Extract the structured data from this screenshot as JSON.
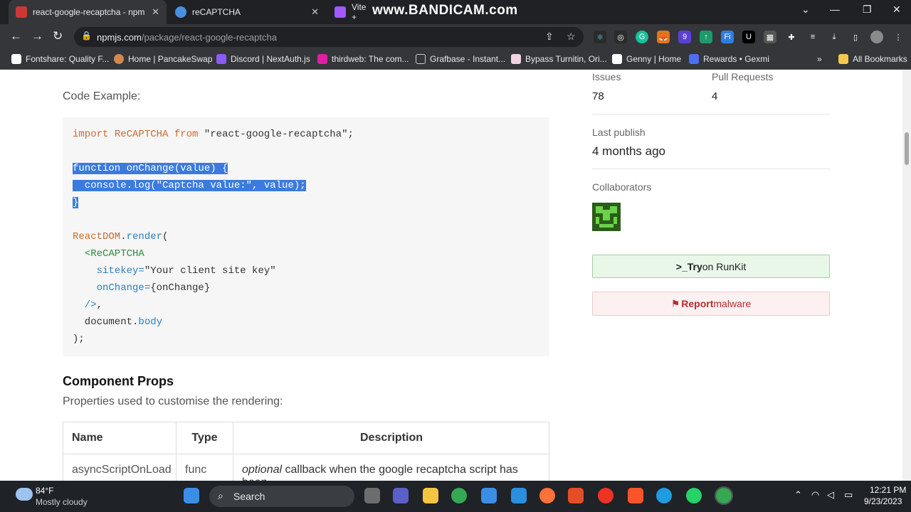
{
  "browser": {
    "tabs": [
      {
        "title": "react-google-recaptcha - npm",
        "active": true,
        "icon": "npm-favicon",
        "color": "#cb3837"
      },
      {
        "title": "reCAPTCHA",
        "active": false,
        "icon": "recaptcha-favicon",
        "color": "#4a90e2"
      },
      {
        "title": "Vite +",
        "active": false,
        "icon": "vite-favicon",
        "color": "#a259ff"
      }
    ],
    "watermark": "www.BANDICAM.com",
    "url_host": "npmjs.com",
    "url_path": "/package/react-google-recaptcha",
    "bookmarks": [
      {
        "label": "Fontshare: Quality F...",
        "icon": "fontshare-icon"
      },
      {
        "label": "Home | PancakeSwap",
        "icon": "pancakeswap-icon"
      },
      {
        "label": "Discord | NextAuth.js",
        "icon": "nextauth-icon"
      },
      {
        "label": "thirdweb: The com...",
        "icon": "thirdweb-icon"
      },
      {
        "label": "Grafbase - Instant...",
        "icon": "grafbase-icon"
      },
      {
        "label": "Bypass Turnitin, Ori...",
        "icon": "bypass-icon"
      },
      {
        "label": "Genny | Home",
        "icon": "genny-icon"
      },
      {
        "label": "Rewards • Gexmi",
        "icon": "gexmi-icon"
      }
    ],
    "bookmarks_overflow": "»",
    "all_bookmarks": "All Bookmarks"
  },
  "main": {
    "code_label": "Code Example:",
    "code": {
      "l1_kw1": "import",
      "l1_id": " ReCAPTCHA ",
      "l1_kw2": "from",
      "l1_str": " \"react-google-recaptcha\";",
      "l3": "function onChange(value) {",
      "l4": "  console.log(\"Captcha value:\", value);",
      "l5": "}",
      "l7_a": "ReactDOM",
      "l7_b": ".",
      "l7_c": "render",
      "l7_d": "(",
      "l8": "  <ReCAPTCHA",
      "l9_attr": "    sitekey=",
      "l9_val": "\"Your client site key\"",
      "l10_attr": "    onChange=",
      "l10_val": "{onChange}",
      "l11": "  />",
      "l11_comma": ",",
      "l12_a": "  document.",
      "l12_b": "body",
      "l13": ");"
    },
    "props_heading": "Component Props",
    "props_desc": "Properties used to customise the rendering:",
    "table": {
      "headers": [
        "Name",
        "Type",
        "Description"
      ],
      "row1": {
        "name": "asyncScriptOnLoad",
        "type": "func",
        "desc_em": "optional",
        "desc": " callback when the google recaptcha script has been"
      }
    }
  },
  "sidebar": {
    "issues_label": "Issues",
    "issues_value": "78",
    "pr_label": "Pull Requests",
    "pr_value": "4",
    "last_publish_label": "Last publish",
    "last_publish_value": "4 months ago",
    "collaborators_label": "Collaborators",
    "runkit_prefix": ">_",
    "runkit_try": "Try",
    "runkit_rest": " on RunKit",
    "report_bold": "Report",
    "report_rest": " malware"
  },
  "taskbar": {
    "weather_temp": "84°F",
    "weather_desc": "Mostly cloudy",
    "search_label": "Search",
    "time": "12:21 PM",
    "date": "9/23/2023"
  }
}
